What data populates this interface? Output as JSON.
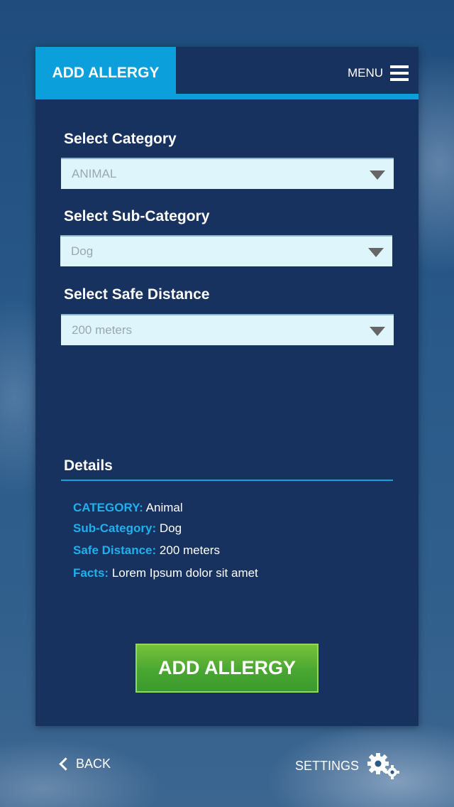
{
  "header": {
    "tab_label": "ADD ALLERGY",
    "menu_label": "MENU"
  },
  "form": {
    "category": {
      "label": "Select Category",
      "value": "ANIMAL"
    },
    "sub_category": {
      "label": "Select Sub-Category",
      "value": "Dog"
    },
    "safe_distance": {
      "label": "Select Safe Distance",
      "value": "200 meters"
    }
  },
  "details": {
    "title": "Details",
    "rows": [
      {
        "key": "CATEGORY:",
        "value": "Animal"
      },
      {
        "key": "Sub-Category:",
        "value": "Dog"
      },
      {
        "key": "Safe Distance:",
        "value": "200 meters"
      },
      {
        "key": "Facts:",
        "value": "Lorem Ipsum dolor sit amet"
      }
    ]
  },
  "actions": {
    "add_label": "ADD ALLERGY"
  },
  "footer": {
    "back_label": "BACK",
    "settings_label": "SETTINGS"
  },
  "icons": {
    "menu": "hamburger-icon",
    "dropdown": "triangle-down-icon",
    "back": "chevron-left-icon",
    "settings": "gears-icon"
  },
  "colors": {
    "accent": "#0b9fdb",
    "card": "#18325f",
    "button": "#4aa632",
    "detail_key": "#1fb0ee"
  }
}
